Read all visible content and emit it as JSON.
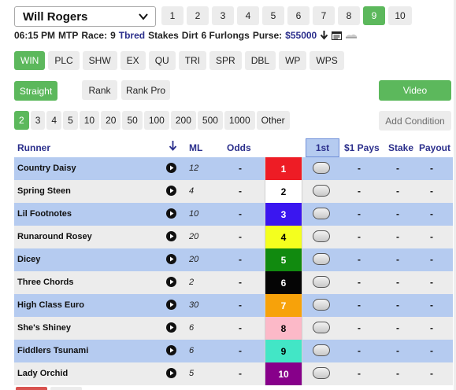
{
  "track": {
    "selected": "Will Rogers"
  },
  "races": {
    "tabs": [
      "1",
      "2",
      "3",
      "4",
      "5",
      "6",
      "7",
      "8",
      "9",
      "10"
    ],
    "active": "9"
  },
  "race_info": {
    "time": "06:15 PM",
    "mtp": "MTP",
    "race_label": "Race:",
    "race_number": "9",
    "breed": "Tbred",
    "race_type": "Stakes",
    "surface": "Dirt",
    "distance": "6 Furlongs",
    "purse_label": "Purse:",
    "purse": "$55000"
  },
  "bet_types": {
    "items": [
      "WIN",
      "PLC",
      "SHW",
      "EX",
      "QU",
      "TRI",
      "SPR",
      "DBL",
      "WP",
      "WPS"
    ],
    "active": "WIN"
  },
  "modes": {
    "straight": "Straight",
    "rank": "Rank",
    "rank_pro": "Rank Pro",
    "video": "Video"
  },
  "amounts": {
    "items": [
      "2",
      "3",
      "4",
      "5",
      "10",
      "20",
      "50",
      "100",
      "200",
      "500",
      "1000",
      "Other"
    ],
    "active": "2",
    "add_condition": "Add Condition"
  },
  "table": {
    "headers": {
      "runner": "Runner",
      "sort_icon": "arrow-down-icon",
      "ml": "ML",
      "odds": "Odds",
      "first": "1st",
      "pays": "$1 Pays",
      "stake": "Stake",
      "payout": "Payout"
    },
    "rows": [
      {
        "name": "Country Daisy",
        "ml": "12",
        "odds": "-",
        "program": "1",
        "bg": "#ee1c25",
        "fg": "#ffffff",
        "pays": "-",
        "stake": "-",
        "payout": "-"
      },
      {
        "name": "Spring Steen",
        "ml": "4",
        "odds": "-",
        "program": "2",
        "bg": "#ffffff",
        "fg": "#000000",
        "pays": "-",
        "stake": "-",
        "payout": "-"
      },
      {
        "name": "Lil Footnotes",
        "ml": "10",
        "odds": "-",
        "program": "3",
        "bg": "#3a16f0",
        "fg": "#ffffff",
        "pays": "-",
        "stake": "-",
        "payout": "-"
      },
      {
        "name": "Runaround Rosey",
        "ml": "20",
        "odds": "-",
        "program": "4",
        "bg": "#f4ff1e",
        "fg": "#000000",
        "pays": "-",
        "stake": "-",
        "payout": "-"
      },
      {
        "name": "Dicey",
        "ml": "20",
        "odds": "-",
        "program": "5",
        "bg": "#118a0f",
        "fg": "#ffffff",
        "pays": "-",
        "stake": "-",
        "payout": "-"
      },
      {
        "name": "Three Chords",
        "ml": "2",
        "odds": "-",
        "program": "6",
        "bg": "#050505",
        "fg": "#ffffff",
        "pays": "-",
        "stake": "-",
        "payout": "-"
      },
      {
        "name": "High Class Euro",
        "ml": "30",
        "odds": "-",
        "program": "7",
        "bg": "#f7a20a",
        "fg": "#ffffff",
        "pays": "-",
        "stake": "-",
        "payout": "-"
      },
      {
        "name": "She's Shiney",
        "ml": "6",
        "odds": "-",
        "program": "8",
        "bg": "#fcb9c8",
        "fg": "#000000",
        "pays": "-",
        "stake": "-",
        "payout": "-"
      },
      {
        "name": "Fiddlers Tsunami",
        "ml": "6",
        "odds": "-",
        "program": "9",
        "bg": "#42e6c6",
        "fg": "#000000",
        "pays": "-",
        "stake": "-",
        "payout": "-"
      },
      {
        "name": "Lady Orchid",
        "ml": "5",
        "odds": "-",
        "program": "10",
        "bg": "#87008a",
        "fg": "#ffffff",
        "pays": "-",
        "stake": "-",
        "payout": "-"
      }
    ]
  },
  "colors": {
    "accent_green": "#5cb85c",
    "header_blue": "#2b2f8c",
    "row_blue": "#b5cbf0",
    "row_gray": "#ececec"
  }
}
